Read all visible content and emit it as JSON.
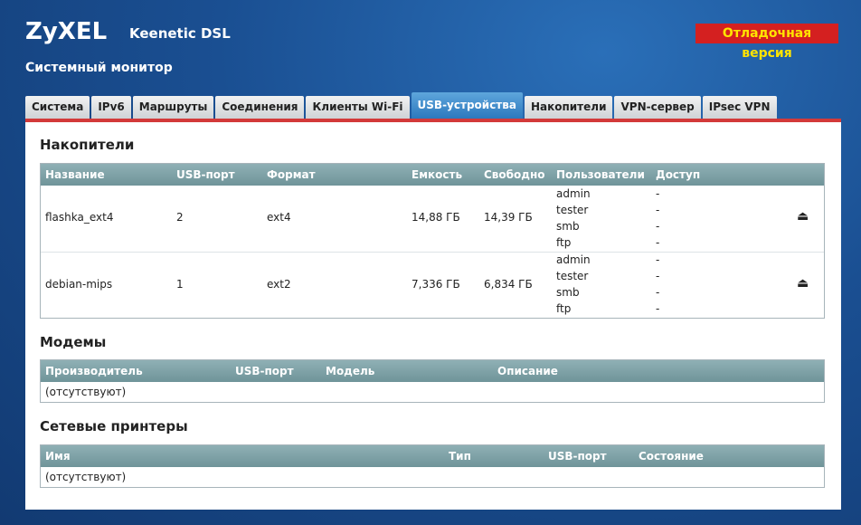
{
  "header": {
    "logo": "ZyXEL",
    "model": "Keenetic DSL",
    "debug_badge": "Отладочная версия",
    "page_title": "Системный монитор"
  },
  "tabs": [
    {
      "label": "Система",
      "active": false
    },
    {
      "label": "IPv6",
      "active": false
    },
    {
      "label": "Маршруты",
      "active": false
    },
    {
      "label": "Соединения",
      "active": false
    },
    {
      "label": "Клиенты Wi-Fi",
      "active": false
    },
    {
      "label": "USB-устройства",
      "active": true
    },
    {
      "label": "Накопители",
      "active": false
    },
    {
      "label": "VPN-сервер",
      "active": false
    },
    {
      "label": "IPsec VPN",
      "active": false
    }
  ],
  "storage": {
    "title": "Накопители",
    "columns": [
      "Название",
      "USB-порт",
      "Формат",
      "Емкость",
      "Свободно",
      "Пользователи",
      "Доступ"
    ],
    "rows": [
      {
        "name": "flashka_ext4",
        "port": "2",
        "format": "ext4",
        "capacity": "14,88 ГБ",
        "free": "14,39 ГБ",
        "users": [
          "admin",
          "tester",
          "smb",
          "ftp"
        ],
        "access": [
          "-",
          "-",
          "-",
          "-"
        ],
        "eject_icon": "eject-icon"
      },
      {
        "name": "debian-mips",
        "port": "1",
        "format": "ext2",
        "capacity": "7,336 ГБ",
        "free": "6,834 ГБ",
        "users": [
          "admin",
          "tester",
          "smb",
          "ftp"
        ],
        "access": [
          "-",
          "-",
          "-",
          "-"
        ],
        "eject_icon": "eject-icon"
      }
    ]
  },
  "modems": {
    "title": "Модемы",
    "columns": [
      "Производитель",
      "USB-порт",
      "Модель",
      "Описание"
    ],
    "empty": "(отсутствуют)"
  },
  "printers": {
    "title": "Сетевые принтеры",
    "columns": [
      "Имя",
      "Тип",
      "USB-порт",
      "Состояние"
    ],
    "empty": "(отсутствуют)"
  },
  "colors": {
    "accent_tab": "#2c78bd",
    "debug_bg": "#d42020",
    "debug_text": "#ffe400",
    "panel_border": "#d33a3a",
    "table_header": "#7fa2a7"
  }
}
